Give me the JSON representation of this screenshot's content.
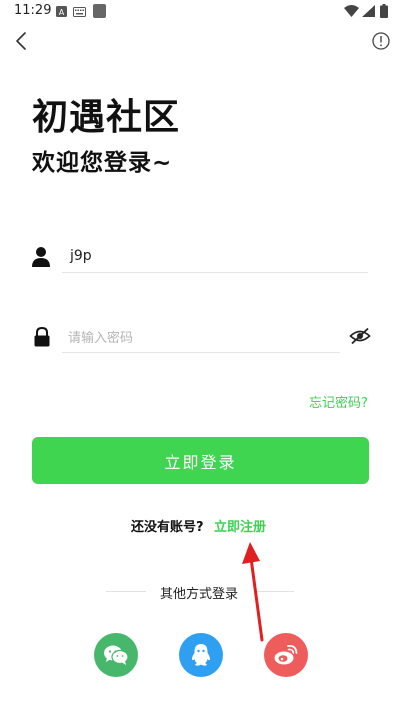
{
  "status_bar": {
    "time": "11:29"
  },
  "header": {
    "title": "初遇社区",
    "subtitle": "欢迎您登录~"
  },
  "login_form": {
    "username_value": "j9p",
    "password_placeholder": "请输入密码",
    "forgot_password": "忘记密码?",
    "login_button": "立即登录"
  },
  "register_prompt": {
    "text": "还没有账号?",
    "link": "立即注册"
  },
  "other_login": {
    "label": "其他方式登录",
    "options": [
      {
        "icon": "wechat-icon",
        "color": "#47b86b"
      },
      {
        "icon": "qq-icon",
        "color": "#2f9ff1"
      },
      {
        "icon": "weibo-icon",
        "color": "#ee5c5c"
      }
    ]
  },
  "colors": {
    "accent": "#3fd551",
    "link": "#3ed052",
    "annotation_arrow": "#e02020"
  }
}
